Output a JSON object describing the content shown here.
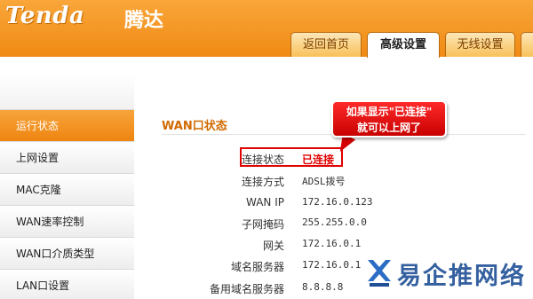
{
  "header": {
    "logo": "Tenda",
    "logo_cn": "腾达",
    "tabs": [
      {
        "label": "返回首页",
        "active": false
      },
      {
        "label": "高级设置",
        "active": true
      },
      {
        "label": "无线设置",
        "active": false
      },
      {
        "label": "",
        "active": false
      }
    ]
  },
  "sidebar": {
    "items": [
      {
        "label": "运行状态",
        "active": true
      },
      {
        "label": "上网设置",
        "active": false
      },
      {
        "label": "MAC克隆",
        "active": false
      },
      {
        "label": "WAN速率控制",
        "active": false
      },
      {
        "label": "WAN口介质类型",
        "active": false
      },
      {
        "label": "LAN口设置",
        "active": false
      }
    ]
  },
  "main": {
    "section_title": "WAN口状态",
    "rows": [
      {
        "label": "连接状态",
        "value": "已连接"
      },
      {
        "label": "连接方式",
        "value": "ADSL拨号"
      },
      {
        "label": "WAN IP",
        "value": "172.16.0.123"
      },
      {
        "label": "子网掩码",
        "value": "255.255.0.0"
      },
      {
        "label": "网关",
        "value": "172.16.0.1"
      },
      {
        "label": "域名服务器",
        "value": "172.16.0.1"
      },
      {
        "label": "备用域名服务器",
        "value": "8.8.8.8"
      }
    ]
  },
  "callout": {
    "line1": "如果显示\"已连接\"",
    "line2": "就可以上网了"
  },
  "watermark": {
    "text": "易企推网络",
    "icon": "watermark-logo-icon"
  },
  "colors": {
    "header_orange": "#f08a14",
    "active_orange": "#ef8511",
    "status_red": "#e00000"
  }
}
